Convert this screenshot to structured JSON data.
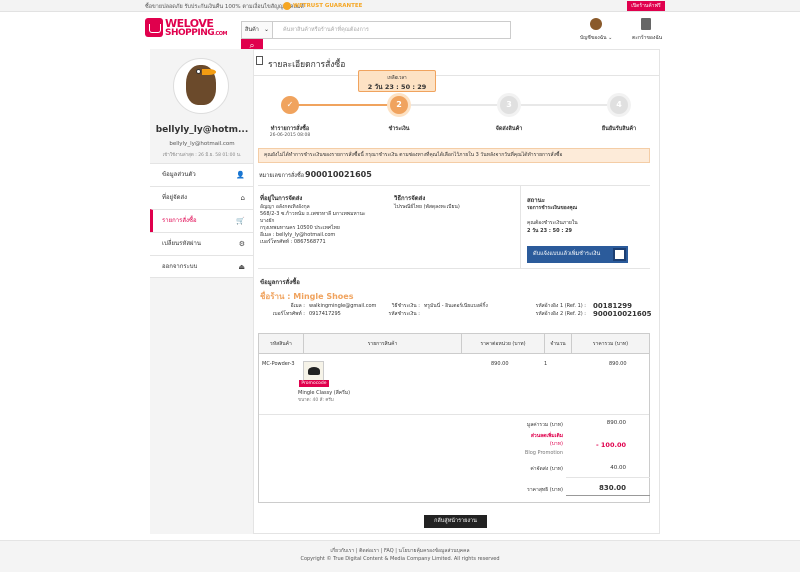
{
  "topbar": {
    "message": "ซื้อขายปลอดภัย รับประกันเงินคืน 100% ตามเงื่อนไขสัญญาอีคอมส์",
    "trust_label": "WETRUST GUARANTEE",
    "open_shop_button": "เปิดร้านค้าฟรี"
  },
  "logo": {
    "line1": "WELOVE",
    "line2": "SHOPPING",
    "suffix": ".COM"
  },
  "search": {
    "category": "สินค้า",
    "placeholder": "ค้นหาสินค้าหรือร้านค้าที่คุณต้องการ"
  },
  "header": {
    "account_label": "บัญชีของฉัน",
    "cart_label": "ตะกร้าของฉัน"
  },
  "user": {
    "username": "bellyly_ly@hotm...",
    "email": "bellyly_ly@hotmail.com",
    "last_login": "เข้าใช้งานล่าสุด : 26 มิ.ย. 58 01:00 น."
  },
  "menu": [
    {
      "label": "ข้อมูลส่วนตัว",
      "icon": "user-icon",
      "glyph": "👤"
    },
    {
      "label": "ที่อยู่จัดส่ง",
      "icon": "home-icon",
      "glyph": "⌂"
    },
    {
      "label": "รายการสั่งซื้อ",
      "icon": "cart-icon",
      "glyph": "🛒",
      "active": true
    },
    {
      "label": "เปลี่ยนรหัสผ่าน",
      "icon": "gear-icon",
      "glyph": "⚙"
    },
    {
      "label": "ออกจากระบบ",
      "icon": "logout-icon",
      "glyph": "⏏"
    }
  ],
  "page_title": "รายละเอียดการสั่งซื้อ",
  "timer": {
    "label": "เหลือเวลา",
    "value": "2 วัน 23 : 50 : 29"
  },
  "steps": [
    {
      "label": "ทำรายการสั่งซื้อ",
      "date": "26-06-2015 08:08",
      "glyph": "✓"
    },
    {
      "label": "ชำระเงิน",
      "date": "",
      "glyph": "2"
    },
    {
      "label": "จัดส่งสินค้า",
      "date": "",
      "glyph": "3"
    },
    {
      "label": "ยืนยันรับสินค้า",
      "date": "",
      "glyph": "4"
    }
  ],
  "alert": "คุณยังไม่ได้ทำการชำระเงินของรายการสั่งซื้อนี้ กรุณาชำระเงิน ตามช่องทางที่คุณได้เลือกไว้ภายใน 3 วันหลังจากวันที่คุณได้ทำรายการสั่งซื้อ",
  "order": {
    "number_label": "หมายเลขการสั่งซื้อ",
    "number": "900010021605"
  },
  "shipping": {
    "heading": "ที่อยู่ในการจัดส่ง",
    "lines": [
      "อัญญา อลังกตเทิงอังกุล",
      "568/2-3 ซ.ก้าวหน้ม ถ.เพชรหาลี มกาเทพมหานะ",
      "บางยัก",
      "กรุงเทพมหานคร 10500 ประเทศไทย",
      "อีเมล : bellyly_ly@hotmail.com",
      "เบอร์โทรศัพท์ : 0867568771"
    ]
  },
  "method": {
    "heading": "วิธีการจัดส่ง",
    "value": "ไปรษณีย์ไทย (พัสดุลงทะเบียน)"
  },
  "status": {
    "heading": "สถานะ",
    "value": "รอการชำระเงินของคุณ",
    "note": "คุณต้องชำระเงินภายใน",
    "countdown": "2 วัน 23 : 50 : 29",
    "pay_button": "ดับแจ้งแบบแล้วเพิ่มชำระเงิน"
  },
  "order_info": {
    "heading": "ข้อมูลการสั่งซื้อ",
    "shop": "ชื่อร้าน : Mingle Shoes",
    "email_label": "อีเมล :",
    "email": "walkingmingle@gmail.com",
    "phone_label": "เบอร์โทรศัพท์ :",
    "phone": "0917417295",
    "pay_label": "วิธีชำระเงิน :",
    "pay_value": "ทรูมันนี่ - อินเตอร์เนียแบงค์กิ้ง",
    "payno_label": "รหัสชำระเงิน :",
    "ref1_label": "รหัสอ้างอิง 1 (Ref. 1) :",
    "ref1": "00181299",
    "ref2_label": "รหัสอ้างอิง 2 (Ref. 2) :",
    "ref2": "900010021605"
  },
  "table": {
    "headers": [
      "รหัสสินค้า",
      "รายการสินค้า",
      "ราคาต่อหน่วย (บาท)",
      "จำนวน",
      "ราคารวม (บาท)"
    ],
    "rows": [
      {
        "sku": "MC-Powder-3",
        "name": "Mingle Classy (สีครีม)",
        "size": "ขนาด: 40 สี: ครีม",
        "badge": "Promocode",
        "unit_price": "890.00",
        "qty": "1",
        "total": "890.00"
      }
    ]
  },
  "totals": {
    "subtotal_label": "มูลค่ารวม (บาท)",
    "subtotal": "890.00",
    "discount_label": "ส่วนลดเพิ่มเติม",
    "discount_unit": "(บาท)",
    "discount": "- 100.00",
    "promo_label": "Blog Promotion",
    "shipping_label": "ค่าจัดส่ง (บาท)",
    "shipping": "40.00",
    "net_label": "ราคาสุทธิ (บาท)",
    "net": "830.00"
  },
  "back_button": "กลับสู่หน้ารายงาน",
  "footer": {
    "links": "เกี่ยวกับเรา | ติดต่อเรา | FAQ | นโยบายคุ้มครองข้อมูลส่วนบุคคล",
    "copyright": "Copyright © True Digital Content & Media Company Limited. All rights reserved"
  },
  "colors": {
    "brand": "#e0004d",
    "accent": "#f0a35e",
    "pay_button": "#2b5b9b"
  }
}
